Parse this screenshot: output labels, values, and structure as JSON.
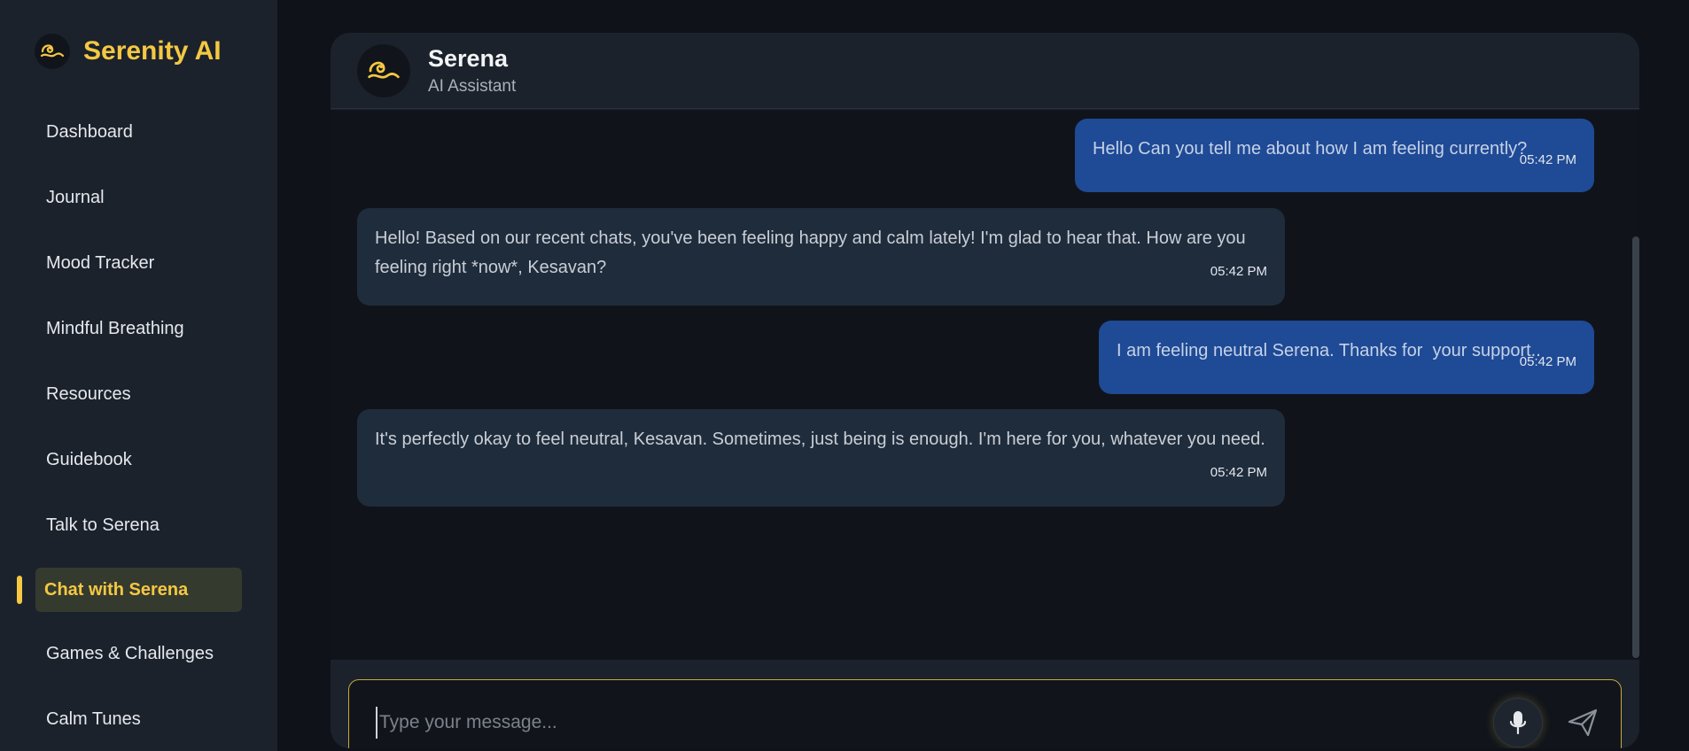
{
  "app": {
    "brand_name": "Serenity AI",
    "brand_color": "#f5c842",
    "logo_icon": "wave-icon"
  },
  "sidebar": {
    "items": [
      {
        "label": "Dashboard"
      },
      {
        "label": "Journal"
      },
      {
        "label": "Mood Tracker"
      },
      {
        "label": "Mindful Breathing"
      },
      {
        "label": "Resources"
      },
      {
        "label": "Guidebook"
      },
      {
        "label": "Talk to Serena"
      },
      {
        "label": "Chat with Serena",
        "active": true
      },
      {
        "label": "Games & Challenges"
      },
      {
        "label": "Calm Tunes"
      }
    ]
  },
  "chat": {
    "header": {
      "name": "Serena",
      "role": "AI Assistant",
      "avatar_icon": "wave-icon"
    },
    "messages": [
      {
        "sender": "user",
        "text": "Hello Can you tell me about how I am feeling currently?",
        "time": "05:42 PM"
      },
      {
        "sender": "assistant",
        "text": "Hello! Based on our recent chats, you've been feeling happy and calm lately! I'm glad to hear that. How are you feeling right *now*, Kesavan?",
        "time": "05:42 PM"
      },
      {
        "sender": "user",
        "text": "I am feeling neutral Serena. Thanks for  your support..",
        "time": "05:42 PM"
      },
      {
        "sender": "assistant",
        "text": "It's perfectly okay to feel neutral, Kesavan. Sometimes, just being is enough. I'm here for you, whatever you need.",
        "time": "05:42 PM"
      }
    ],
    "composer": {
      "placeholder": "Type your message...",
      "value": "",
      "mic_icon": "microphone-icon",
      "send_icon": "send-icon"
    }
  },
  "colors": {
    "user_bubble": "#1f4a95",
    "assistant_bubble": "#1f2c3b",
    "accent": "#f5c842"
  }
}
